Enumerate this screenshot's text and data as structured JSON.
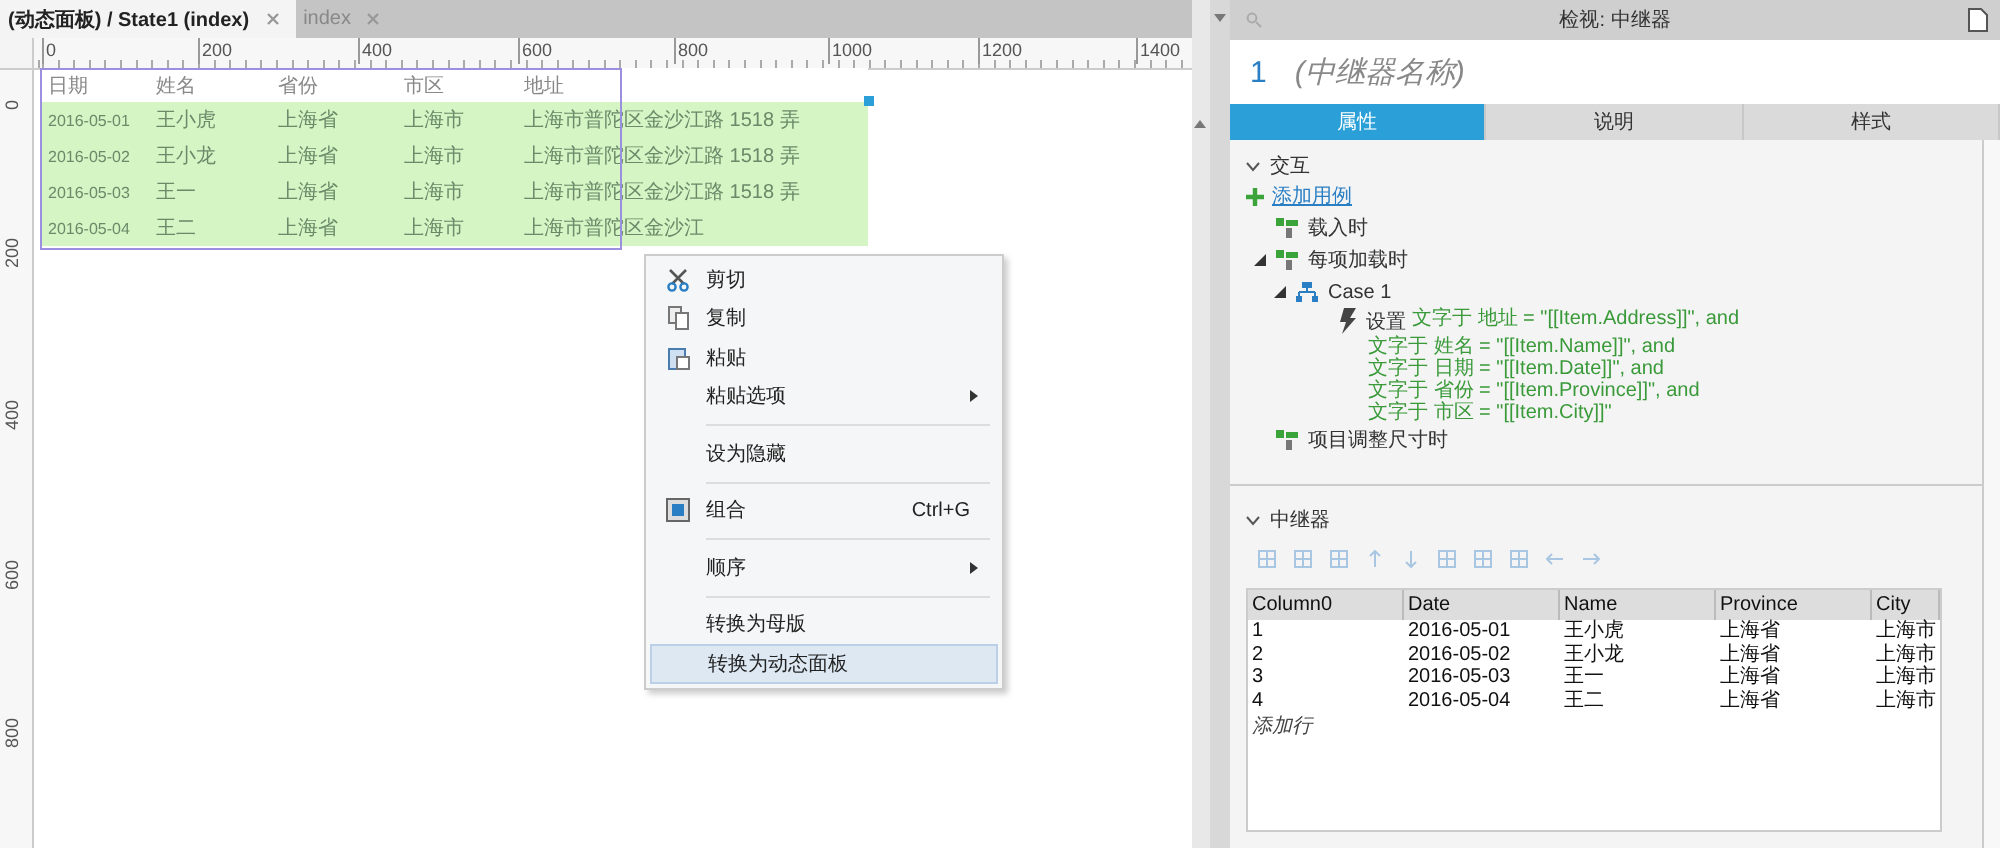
{
  "tabs": [
    {
      "label": "(动态面板) / State1 (index)",
      "selected": true
    },
    {
      "label": "index",
      "selected": false
    }
  ],
  "ruler": {
    "x_labels": [
      "0",
      "200",
      "400",
      "600",
      "800",
      "1000",
      "1200",
      "1400"
    ],
    "y_labels": [
      "0",
      "200",
      "400",
      "600",
      "800"
    ]
  },
  "repeater_widget": {
    "columns": [
      "日期",
      "姓名",
      "省份",
      "市区",
      "地址"
    ],
    "rows": [
      [
        "2016-05-01",
        "王小虎",
        "上海省",
        "上海市",
        "上海市普陀区金沙江路 1518 弄"
      ],
      [
        "2016-05-02",
        "王小龙",
        "上海省",
        "上海市",
        "上海市普陀区金沙江路 1518 弄"
      ],
      [
        "2016-05-03",
        "王一",
        "上海省",
        "上海市",
        "上海市普陀区金沙江路 1518 弄"
      ],
      [
        "2016-05-04",
        "王二",
        "上海省",
        "上海市",
        "上海市普陀区金沙江"
      ]
    ]
  },
  "context_menu": {
    "items": [
      {
        "kind": "item",
        "label": "剪切",
        "selected": false
      },
      {
        "kind": "item",
        "label": "复制",
        "selected": false
      },
      {
        "kind": "item",
        "label": "粘贴",
        "selected": false
      },
      {
        "kind": "item",
        "label": "粘贴选项",
        "submenu": true,
        "selected": false
      },
      {
        "kind": "separator"
      },
      {
        "kind": "item",
        "label": "设为隐藏",
        "selected": false
      },
      {
        "kind": "separator"
      },
      {
        "kind": "item",
        "label": "组合",
        "shortcut": "Ctrl+G",
        "selected": false
      },
      {
        "kind": "separator"
      },
      {
        "kind": "item",
        "label": "顺序",
        "submenu": true,
        "selected": false
      },
      {
        "kind": "separator"
      },
      {
        "kind": "item",
        "label": "转换为母版",
        "selected": false
      },
      {
        "kind": "item",
        "label": "转换为动态面板",
        "selected": true
      }
    ]
  },
  "inspector": {
    "title": "检视: 中继器",
    "number": "1",
    "name": "(中继器名称)",
    "tabs": [
      {
        "label": "属性",
        "selected": true
      },
      {
        "label": "说明",
        "selected": false
      },
      {
        "label": "样式",
        "selected": false
      }
    ],
    "interactions": {
      "heading": "交互",
      "expanded": true,
      "add_case": "添加用例",
      "events": [
        {
          "label": "载入时"
        },
        {
          "label": "每项加载时",
          "expanded": true,
          "children": [
            {
              "label": "Case 1",
              "expanded": true,
              "action": "设置",
              "details": [
                "文字于 地址 = \"[[Item.Address]]\", and",
                "文字于 姓名 = \"[[Item.Name]]\", and",
                "文字于 日期 = \"[[Item.Date]]\", and",
                "文字于 省份 = \"[[Item.Province]]\", and",
                "文字于 市区 = \"[[Item.City]]\""
              ]
            }
          ]
        },
        {
          "label": "项目调整尺寸时"
        }
      ]
    },
    "repeater": {
      "heading": "中继器",
      "expanded": true,
      "columns": [
        "Column0",
        "Date",
        "Name",
        "Province",
        "City"
      ],
      "rows": [
        [
          "1",
          "2016-05-01",
          "王小虎",
          "上海省",
          "上海市"
        ],
        [
          "2",
          "2016-05-02",
          "王小龙",
          "上海省",
          "上海市"
        ],
        [
          "3",
          "2016-05-03",
          "王一",
          "上海省",
          "上海市"
        ],
        [
          "4",
          "2016-05-04",
          "王二",
          "上海省",
          "上海市"
        ]
      ],
      "add_row": "添加行"
    }
  }
}
